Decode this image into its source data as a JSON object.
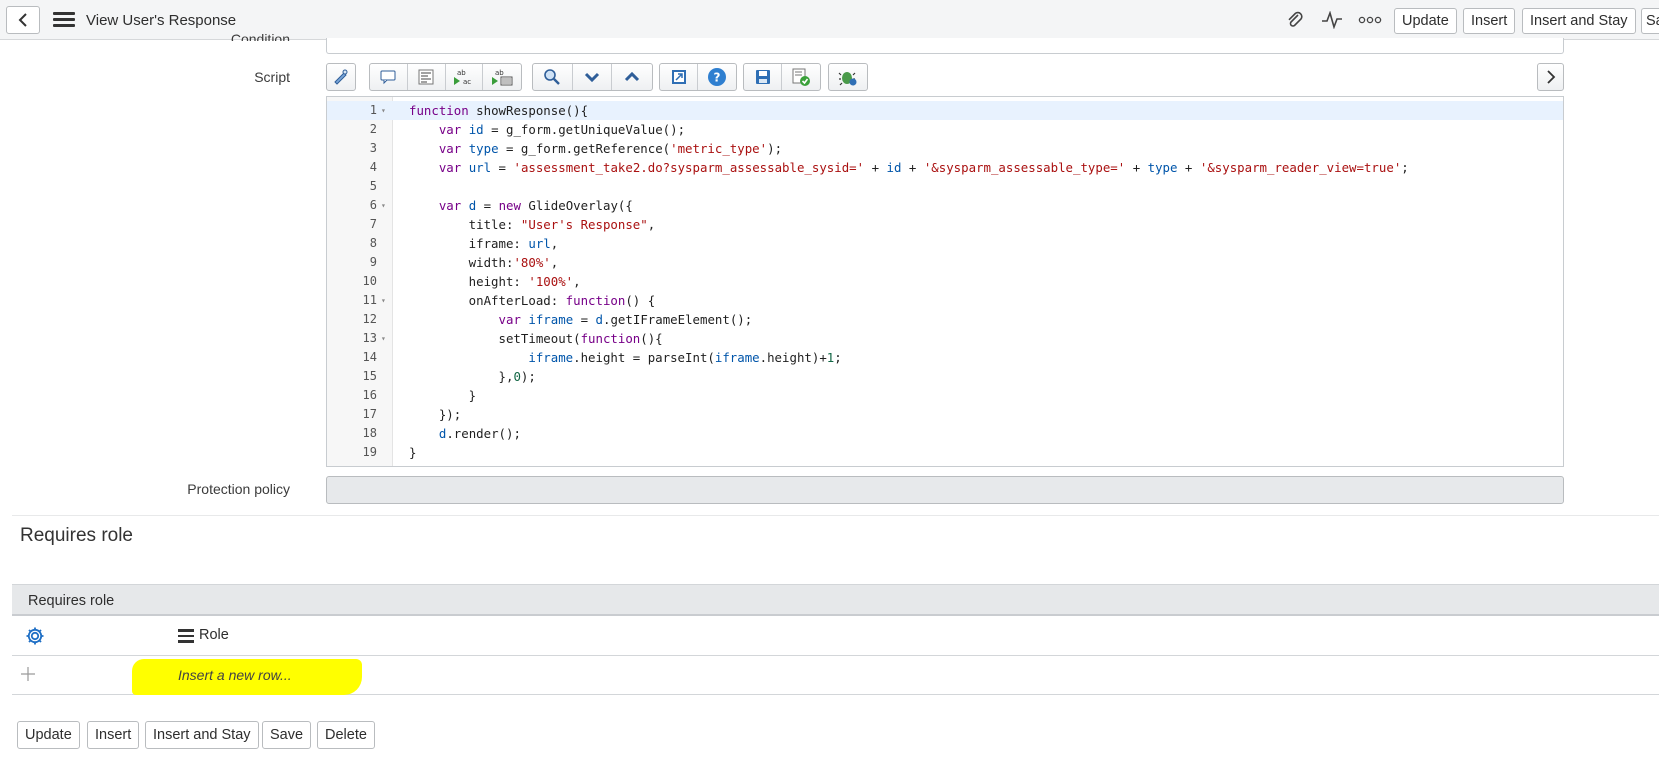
{
  "header": {
    "title": "View User's Response",
    "buttons": {
      "update": "Update",
      "insert": "Insert",
      "insert_and_stay": "Insert and Stay",
      "save": "Save"
    }
  },
  "form": {
    "condition_label": "Condition",
    "script_label": "Script",
    "protection_policy_label": "Protection policy",
    "script_lines": [
      "function showResponse(){",
      "    var id = g_form.getUniqueValue();",
      "    var type = g_form.getReference('metric_type');",
      "    var url = 'assessment_take2.do?sysparm_assessable_sysid=' + id + '&sysparm_assessable_type=' + type + '&sysparm_reader_view=true';",
      "",
      "    var d = new GlideOverlay({",
      "        title: \"User's Response\",",
      "        iframe: url,",
      "        width:'80%',",
      "        height: '100%',",
      "        onAfterLoad: function() {",
      "            var iframe = d.getIFrameElement();",
      "            setTimeout(function(){",
      "                iframe.height = parseInt(iframe.height)+1;",
      "            },0);",
      "        }",
      "    });",
      "    d.render();",
      "}"
    ],
    "line_numbers": [
      "1",
      "2",
      "3",
      "4",
      "5",
      "6",
      "7",
      "8",
      "9",
      "10",
      "11",
      "12",
      "13",
      "14",
      "15",
      "16",
      "17",
      "18",
      "19"
    ]
  },
  "toolbar_icons": [
    "edit-script-icon",
    "comment-icon",
    "format-icon",
    "replace-icon",
    "replace-all-icon",
    "search-icon",
    "search-down-icon",
    "search-up-icon",
    "fullscreen-icon",
    "help-icon",
    "save-icon",
    "check-syntax-icon",
    "debug-icon",
    "expand-right-icon"
  ],
  "related_list": {
    "section_title": "Requires role",
    "list_title": "Requires role",
    "column_role": "Role",
    "insert_row": "Insert a new row..."
  },
  "footer_buttons": {
    "update": "Update",
    "insert": "Insert",
    "insert_and_stay": "Insert and Stay",
    "save": "Save",
    "delete": "Delete"
  },
  "colors": {
    "highlight": "#ffff00",
    "accent": "#1f6fc5"
  }
}
